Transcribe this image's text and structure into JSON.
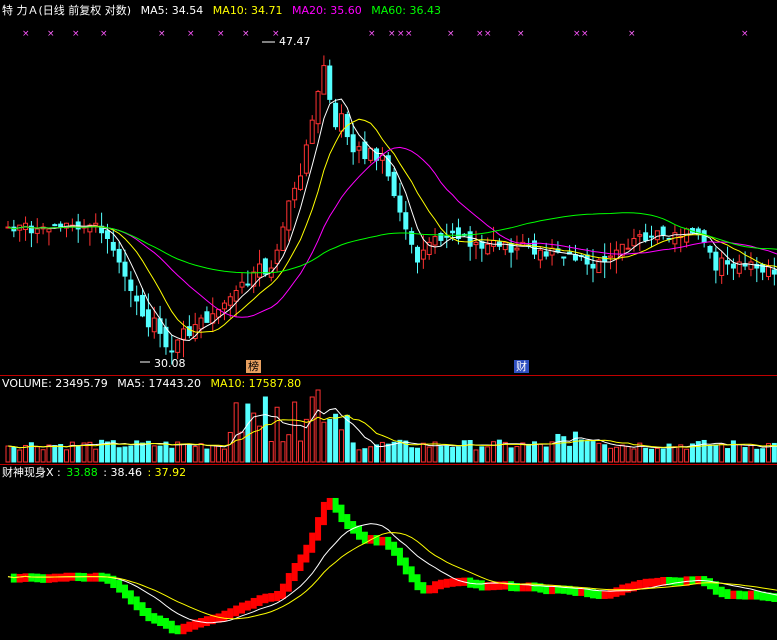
{
  "price_panel": {
    "title": "特 力Ａ(日线 前复权 对数)",
    "ma5_label": "MA5: 34.54",
    "ma10_label": "MA10: 34.71",
    "ma20_label": "MA20: 35.60",
    "ma60_label": "MA60: 36.43",
    "high_label": "47.47",
    "low_label": "30.08",
    "marker_bang": "榜",
    "marker_cai": "财",
    "signal_mark": "×"
  },
  "volume_panel": {
    "vol_label": "VOLUME: 23495.79",
    "ma5_label": "MA5: 17443.20",
    "ma10_label": "MA10: 17587.80"
  },
  "indicator_panel": {
    "name_label": "财神现身X :",
    "v1_label": "33.88",
    "v2_label": ": 38.46",
    "v3_label": ": 37.92"
  },
  "colors": {
    "up": "#ff3232",
    "down": "#54ffff",
    "ma5": "#ffffff",
    "ma10": "#ffff00",
    "ma20": "#ff00ff",
    "ma60": "#00ff00",
    "ind_up": "#ff0000",
    "ind_down": "#00ff00",
    "separator": "#c00000"
  },
  "chart_data": [
    {
      "type": "candlestick",
      "title": "特 力Ａ(日线 前复权 对数)",
      "y_range": [
        29.5,
        49
      ],
      "high": 47.47,
      "low": 30.08,
      "closes": [
        36.4,
        36.2,
        36.5,
        36.6,
        36.1,
        36.3,
        36.4,
        36.3,
        36.5,
        36.4,
        36.6,
        36.5,
        36.3,
        36.4,
        36.5,
        36.6,
        36.1,
        35.8,
        35.2,
        34.6,
        33.9,
        33.2,
        32.7,
        32.0,
        31.5,
        31.9,
        31.2,
        30.6,
        30.4,
        30.9,
        31.4,
        31.1,
        31.6,
        31.9,
        31.7,
        32.1,
        32.3,
        32.6,
        32.9,
        33.2,
        33.6,
        33.5,
        34.1,
        34.5,
        34.0,
        34.3,
        35.2,
        36.4,
        37.8,
        38.5,
        39.2,
        41.0,
        42.5,
        44.3,
        46.0,
        43.8,
        42.1,
        42.9,
        41.5,
        40.6,
        40.9,
        40.2,
        40.8,
        40.1,
        40.4,
        39.2,
        38.1,
        37.2,
        36.3,
        35.5,
        34.6,
        35.2,
        35.6,
        35.9,
        35.7,
        35.9,
        36.1,
        35.8,
        36.0,
        35.4,
        35.6,
        35.3,
        35.5,
        35.7,
        35.4,
        35.6,
        35.1,
        35.3,
        35.6,
        35.4,
        35.0,
        35.2,
        34.9,
        35.3,
        35.1,
        34.8,
        35.0,
        34.7,
        34.9,
        34.5,
        34.3,
        34.7,
        34.6,
        34.9,
        35.2,
        35.5,
        35.3,
        35.8,
        36.0,
        35.7,
        35.9,
        36.2,
        36.0,
        35.8,
        36.1,
        35.9,
        36.3,
        36.1,
        36.0,
        35.6,
        35.1,
        34.2,
        34.8,
        34.5,
        34.3,
        34.6,
        34.4,
        34.6,
        34.3,
        34.1,
        34.4,
        34.0,
        33.8,
        34.2,
        34.54
      ],
      "series": [
        {
          "name": "MA5",
          "value": 34.54
        },
        {
          "name": "MA10",
          "value": 34.71
        },
        {
          "name": "MA20",
          "value": 35.6
        },
        {
          "name": "MA60",
          "value": 36.43
        }
      ]
    },
    {
      "type": "bar",
      "title": "VOLUME",
      "last_value": 23495.79,
      "series": [
        {
          "name": "MA5",
          "value": 17443.2
        },
        {
          "name": "MA10",
          "value": 17587.8
        }
      ]
    },
    {
      "type": "area",
      "title": "财神现身X",
      "values": [
        33.88,
        38.46,
        37.92
      ]
    }
  ]
}
